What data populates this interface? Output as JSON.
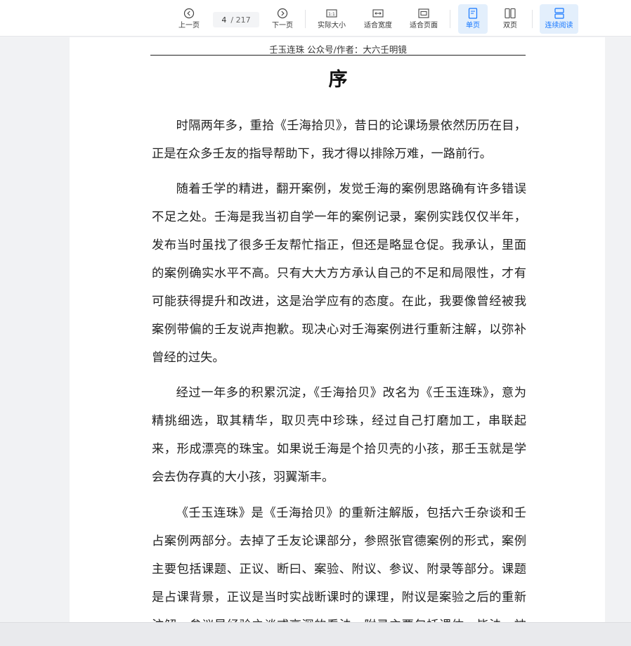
{
  "toolbar": {
    "prev_label": "上一页",
    "next_label": "下一页",
    "current_page": "4",
    "total_pages": "/ 217",
    "actual_size_label": "实际大小",
    "fit_width_label": "适合宽度",
    "fit_page_label": "适合页面",
    "single_page_label": "单页",
    "double_page_label": "双页",
    "continuous_label": "连续阅读",
    "accent_color": "#1677ff"
  },
  "page": {
    "running_head": "壬玉连珠  公众号/作者：大六壬明镜",
    "title": "序",
    "paragraphs": [
      "时隔两年多，重拾《壬海拾贝》，昔日的论课场景依然历历在目，正是在众多壬友的指导帮助下，我才得以排除万难，一路前行。",
      "随着壬学的精进，翻开案例，发觉壬海的案例思路确有许多错误不足之处。壬海是我当初自学一年的案例记录，案例实践仅仅半年，发布当时虽找了很多壬友帮忙指正，但还是略显仓促。我承认，里面的案例确实水平不高。只有大大方方承认自己的不足和局限性，才有可能获得提升和改进，这是治学应有的态度。在此，我要像曾经被我案例带偏的壬友说声抱歉。现决心对壬海案例进行重新注解，以弥补曾经的过失。",
      "经过一年多的积累沉淀，《壬海拾贝》改名为《壬玉连珠》，意为精挑细选，取其精华，取贝壳中珍珠，经过自己打磨加工，串联起来，形成漂亮的珠宝。如果说壬海是个拾贝壳的小孩，那壬玉就是学会去伪存真的大小孩，羽翼渐丰。",
      "《壬玉连珠》是《壬海拾贝》的重新注解版，包括六壬杂谈和壬占案例两部分。去掉了壬友论课部分，参照张官德案例的形式，案例主要包括课题、正议、断曰、案验、附议、参议、附录等部分。课题是占课背景，正议是当时实战断课时的课理，附议是案验之后的重新注解，参议是经验之谈或高深的看法，附录主要包括课体、毕法、神煞"
    ]
  }
}
